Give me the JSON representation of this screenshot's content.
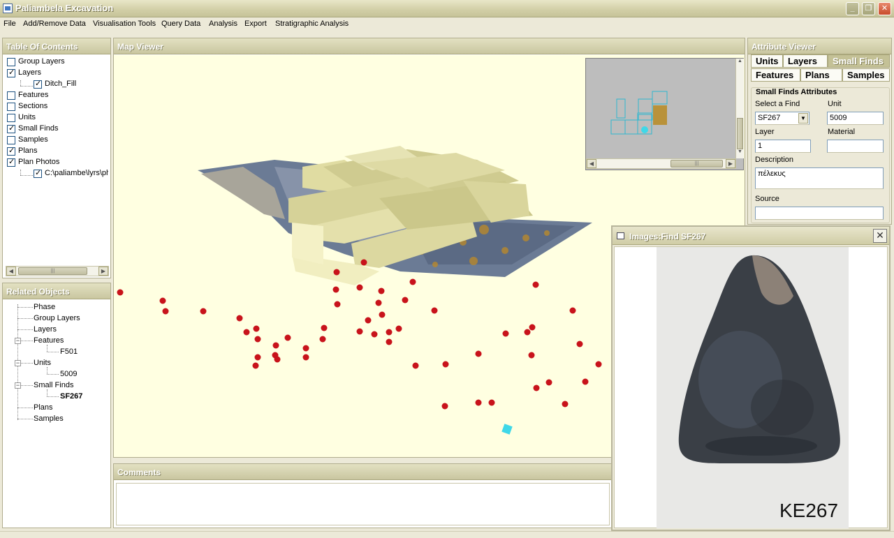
{
  "window": {
    "title": "Paliambela Excavation"
  },
  "menu": [
    "File",
    "Add/Remove Data",
    "Visualisation Tools",
    "Query Data",
    "Analysis",
    "Export",
    "Stratigraphic Analysis"
  ],
  "toc": {
    "header": "Table Of Contents",
    "items": [
      {
        "label": "Group Layers",
        "checked": false,
        "level": 0
      },
      {
        "label": "Layers",
        "checked": true,
        "level": 0
      },
      {
        "label": "Ditch_Fill",
        "checked": true,
        "level": 1
      },
      {
        "label": "Features",
        "checked": false,
        "level": 0
      },
      {
        "label": "Sections",
        "checked": false,
        "level": 0
      },
      {
        "label": "Units",
        "checked": false,
        "level": 0
      },
      {
        "label": "Small Finds",
        "checked": true,
        "level": 0
      },
      {
        "label": "Samples",
        "checked": false,
        "level": 0
      },
      {
        "label": "Plans",
        "checked": true,
        "level": 0
      },
      {
        "label": "Plan Photos",
        "checked": true,
        "level": 0
      },
      {
        "label": "C:\\paliambe\\lyrs\\ph",
        "checked": true,
        "level": 1
      }
    ]
  },
  "related": {
    "header": "Related Objects",
    "items": [
      {
        "label": "Phase",
        "level": 0,
        "expander": ""
      },
      {
        "label": "Group Layers",
        "level": 0,
        "expander": ""
      },
      {
        "label": "Layers",
        "level": 0,
        "expander": ""
      },
      {
        "label": "Features",
        "level": 0,
        "expander": "−"
      },
      {
        "label": "F501",
        "level": 1,
        "expander": ""
      },
      {
        "label": "Units",
        "level": 0,
        "expander": "−"
      },
      {
        "label": "5009",
        "level": 1,
        "expander": ""
      },
      {
        "label": "Small Finds",
        "level": 0,
        "expander": "−"
      },
      {
        "label": "SF267",
        "level": 1,
        "expander": "",
        "bold": true
      },
      {
        "label": "Plans",
        "level": 0,
        "expander": ""
      },
      {
        "label": "Samples",
        "level": 0,
        "expander": ""
      }
    ]
  },
  "map": {
    "header": "Map Viewer"
  },
  "comments": {
    "header": "Comments"
  },
  "attributes": {
    "header": "Attribute Viewer",
    "tabs": [
      "Units",
      "Layers",
      "Small Finds",
      "Features",
      "Plans",
      "Samples"
    ],
    "active_tab": "Small Finds",
    "group_title": "Small Finds Attributes",
    "select_label": "Select a Find",
    "select_value": "SF267",
    "unit_label": "Unit",
    "unit_value": "5009",
    "layer_label": "Layer",
    "layer_value": "1",
    "material_label": "Material",
    "material_value": "",
    "description_label": "Description",
    "description_value": "πέλεκυς",
    "source_label": "Source",
    "source_value": ""
  },
  "image_window": {
    "title": "Images:Find SF267",
    "caption": "KE267"
  },
  "colors": {
    "finds_dot": "#c8131b",
    "selected_find": "#3fd8e8",
    "map_background": "#ffffe1"
  }
}
